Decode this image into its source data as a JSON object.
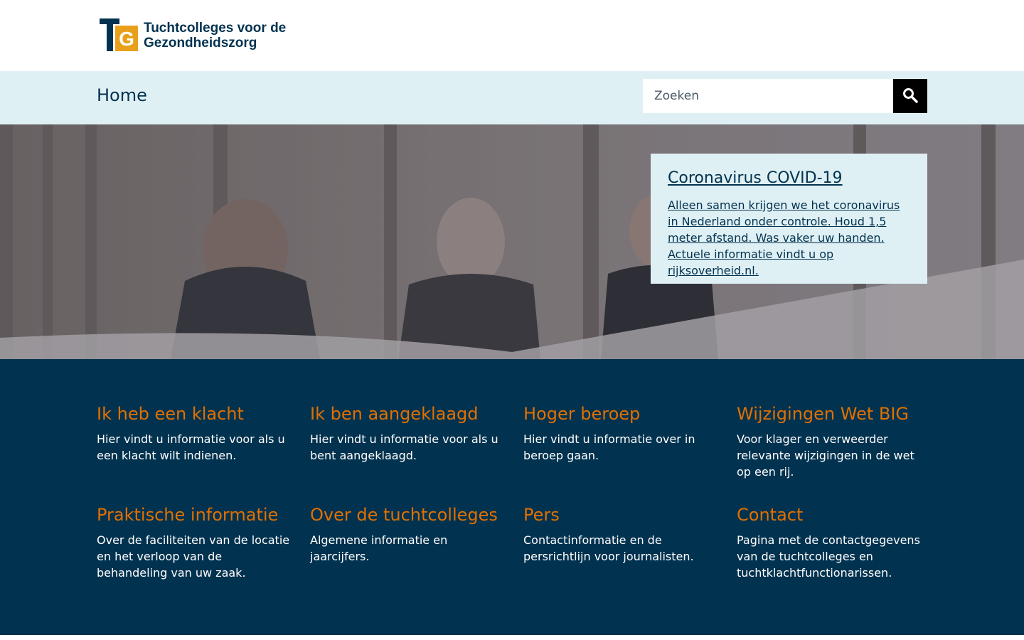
{
  "site": {
    "logo_initials": "TG",
    "logo_line1": "Tuchtcolleges voor de",
    "logo_line2": "Gezondheidszorg"
  },
  "nav": {
    "home_label": "Home"
  },
  "search": {
    "placeholder": "Zoeken",
    "value": "",
    "button_icon": "search-icon"
  },
  "notice": {
    "title": "Coronavirus COVID-19",
    "text": "Alleen samen krijgen we het coronavirus in Nederland onder controle. Houd 1,5 meter afstand. Was vaker uw handen. Actuele informatie vindt u op rijksoverheid.nl."
  },
  "tiles": [
    {
      "title": "Ik heb een klacht",
      "text": "Hier vindt u informatie voor als u een klacht wilt indienen."
    },
    {
      "title": "Ik ben aangeklaagd",
      "text": "Hier vindt u informatie voor als u bent aangeklaagd."
    },
    {
      "title": "Hoger beroep",
      "text": "Hier vindt u informatie over in beroep gaan."
    },
    {
      "title": "Wijzigingen Wet BIG",
      "text": "Voor klager en verweerder relevante wijzigingen in de wet op een rij."
    },
    {
      "title": "Praktische informatie",
      "text": "Over de faciliteiten van de locatie en het verloop van de behandeling van uw zaak."
    },
    {
      "title": "Over de tuchtcolleges",
      "text": "Algemene informatie en jaarcijfers."
    },
    {
      "title": "Pers",
      "text": "Contactinformatie en de persrichtlijn voor journalisten."
    },
    {
      "title": "Contact",
      "text": "Pagina met de contactgegevens van de tuchtcolleges en tuchtklachtfunctionarissen."
    }
  ],
  "colors": {
    "navy": "#01324f",
    "orange": "#e17000",
    "light_blue": "#dff0f4"
  }
}
